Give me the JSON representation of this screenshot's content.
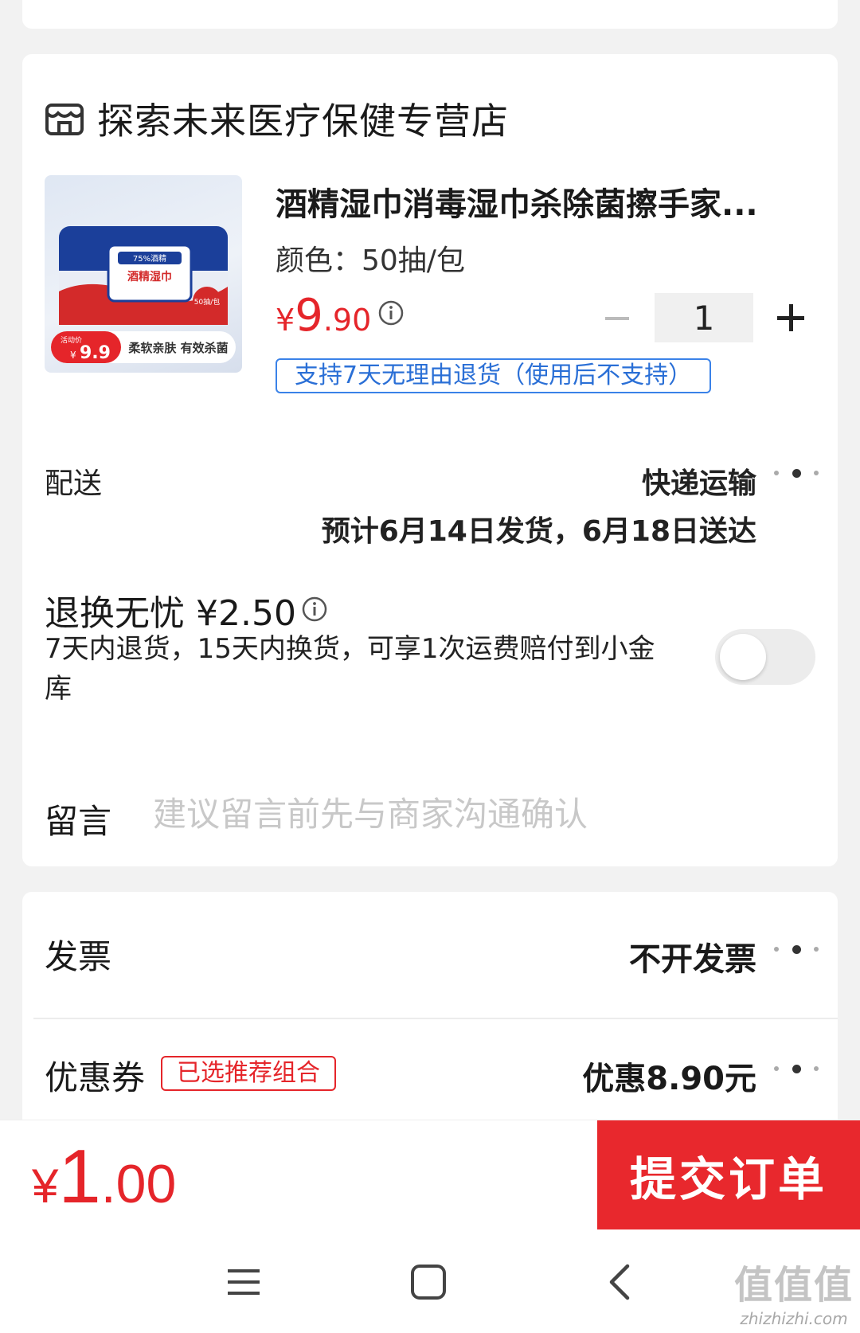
{
  "store": {
    "name": "探索未来医疗保健专营店"
  },
  "product": {
    "title": "酒精湿巾消毒湿巾杀除菌擦手家...",
    "spec": "颜色：50抽/包",
    "price_yen": "¥",
    "price_int": "9",
    "price_dec": ".90",
    "quantity": "1",
    "return_tag": "支持7天无理由退货（使用后不支持）",
    "image": {
      "badge_concentration": "75%酒精",
      "package_label": "酒精湿巾",
      "count_badge": "50抽/包",
      "promo_prefix": "活动价",
      "promo_yen": "¥",
      "promo_price": "9.9",
      "promo_text": "柔软亲肤 有效杀菌"
    }
  },
  "shipping": {
    "label": "配送",
    "method": "快递运输",
    "eta": "预计6月14日发货，6月18日送达"
  },
  "worry_free": {
    "title": "退换无忧 ¥2.50",
    "description": "7天内退货，15天内换货，可享1次运费赔付到小金库",
    "enabled": false
  },
  "message": {
    "label": "留言",
    "placeholder": "建议留言前先与商家沟通确认"
  },
  "invoice": {
    "label": "发票",
    "value": "不开发票"
  },
  "coupon": {
    "label": "优惠券",
    "tag": "已选推荐组合",
    "value": "优惠8.90元"
  },
  "footer": {
    "total_yen": "¥",
    "total_int": "1",
    "total_dec": ".00",
    "submit_label": "提交订单"
  },
  "watermark": {
    "big": "值值值",
    "small": "zhizhizhi.com"
  },
  "colors": {
    "accent": "#e8282d",
    "link_blue": "#2a6fd6"
  },
  "icons": [
    "store-icon",
    "info-icon",
    "more-dots-icon",
    "menu-icon",
    "home-icon",
    "back-icon"
  ]
}
